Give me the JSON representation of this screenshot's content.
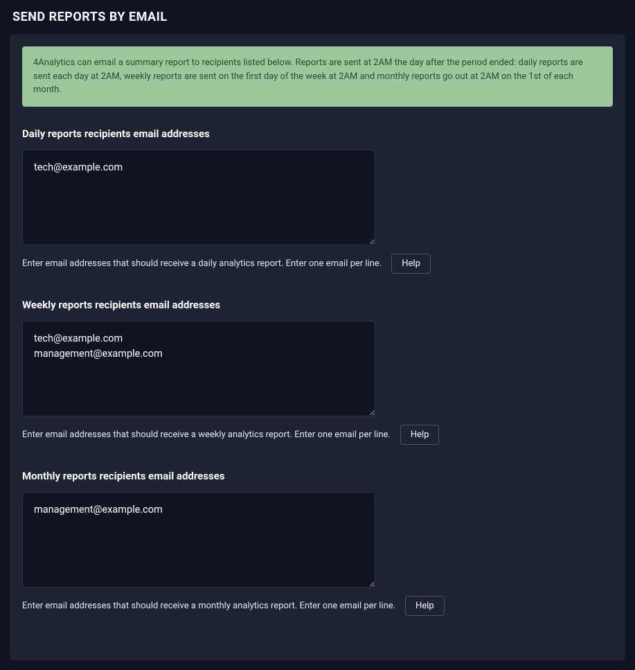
{
  "page_title": "SEND REPORTS BY EMAIL",
  "info_banner": "4Analytics can email a summary report to recipients listed below. Reports are sent at 2AM the day after the period ended: daily reports are sent each day at 2AM, weekly reports are sent on the first day of the week at 2AM and monthly reports go out at 2AM on the 1st of each month.",
  "help_label": "Help",
  "sections": {
    "daily": {
      "label": "Daily reports recipients email addresses",
      "value": "tech@example.com",
      "helper": "Enter email addresses that should receive a daily analytics report. Enter one email per line."
    },
    "weekly": {
      "label": "Weekly reports recipients email addresses",
      "value": "tech@example.com\nmanagement@example.com",
      "helper": "Enter email addresses that should receive a weekly analytics report. Enter one email per line."
    },
    "monthly": {
      "label": "Monthly reports recipients email addresses",
      "value": "management@example.com",
      "helper": "Enter email addresses that should receive a monthly analytics report. Enter one email per line."
    }
  }
}
